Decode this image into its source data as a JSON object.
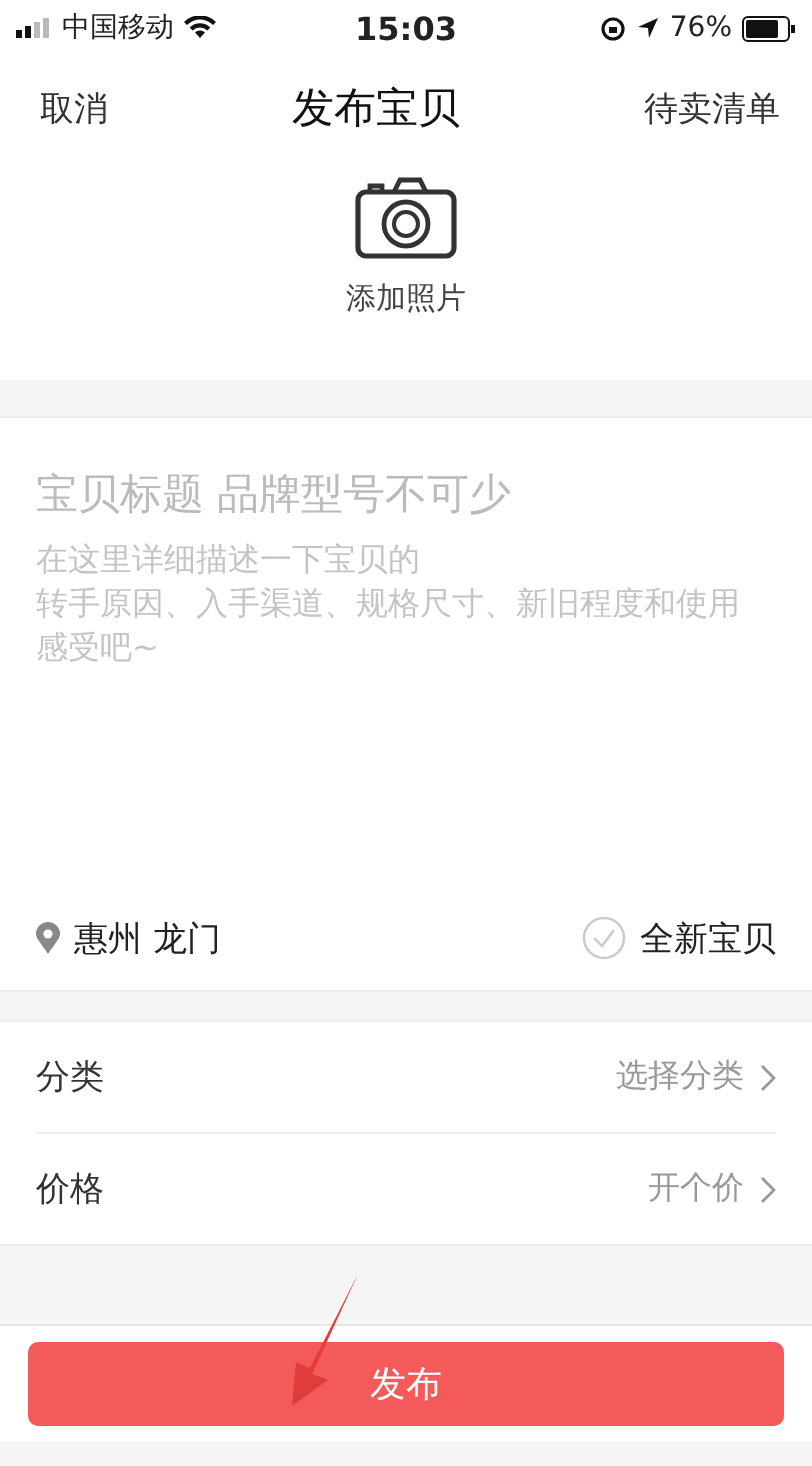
{
  "status_bar": {
    "carrier": "中国移动",
    "time": "15:03",
    "battery": "76%"
  },
  "nav": {
    "left": "取消",
    "title": "发布宝贝",
    "right": "待卖清单"
  },
  "photo": {
    "label": "添加照片"
  },
  "editor": {
    "title_placeholder": "宝贝标题 品牌型号不可少",
    "description_lines": [
      "在这里详细描述一下宝贝的",
      "转手原因、入手渠道、规格尺寸、新旧程度和使用感受吧~"
    ]
  },
  "location": {
    "text": "惠州 龙门"
  },
  "brand_new": {
    "label": "全新宝贝",
    "checked": false
  },
  "rows": [
    {
      "label": "分类",
      "value": "选择分类"
    },
    {
      "label": "价格",
      "value": "开个价"
    }
  ],
  "publish_button": {
    "label": "发布"
  },
  "annotation": {
    "kind": "arrow"
  }
}
